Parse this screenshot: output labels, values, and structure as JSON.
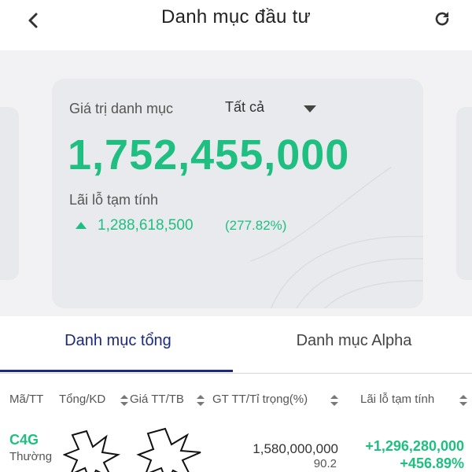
{
  "header": {
    "title": "Danh mục đầu tư",
    "back_icon": "chevron-left-icon",
    "refresh_icon": "refresh-icon"
  },
  "portfolio_card": {
    "label": "Giá trị danh mục",
    "filter_value": "Tất cả",
    "total_value": "1,752,455,000",
    "pnl_label": "Lãi lỗ tạm tính",
    "pnl_value": "1,288,618,500",
    "pnl_percent": "(277.82%)"
  },
  "tabs": [
    {
      "label": "Danh mục tổng",
      "active": true
    },
    {
      "label": "Danh mục Alpha",
      "active": false
    }
  ],
  "table": {
    "columns": [
      "Mã/TT",
      "Tổng/KD",
      "Giá TT/TB",
      "GT TT/Tỉ trọng(%)",
      "Lãi lỗ tạm tính"
    ],
    "rows": [
      {
        "symbol": "C4G",
        "status": "Thường",
        "market_value": "1,580,000,000",
        "weight": "90.2",
        "pnl": "+1,296,280,000",
        "pnl_percent": "+456.89%"
      }
    ]
  },
  "colors": {
    "accent_green": "#1fbf82",
    "tab_active": "#1c2a7a",
    "background": "#f2f2f4"
  }
}
